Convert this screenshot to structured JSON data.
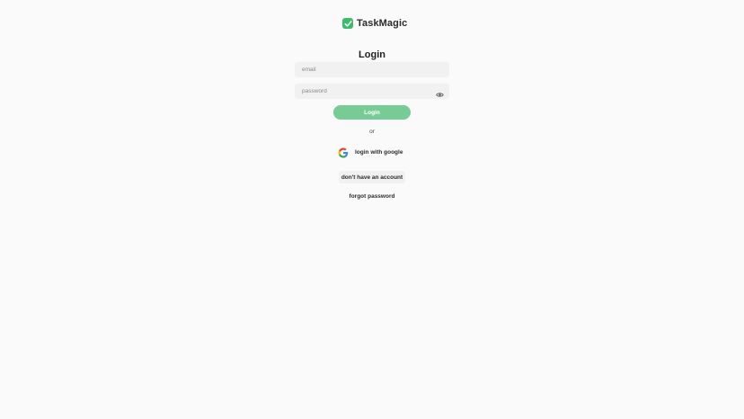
{
  "brand": {
    "name": "TaskMagic",
    "accent_color": "#3dbb6d",
    "logo_icon": "checkmark-badge-icon"
  },
  "login_form": {
    "title": "Login",
    "email": {
      "placeholder": "email",
      "value": ""
    },
    "password": {
      "placeholder": "password",
      "value": "",
      "toggle_icon": "eye-icon"
    },
    "submit_label": "Login",
    "submit_color": "#77cc95",
    "divider_text": "or",
    "google": {
      "label": "login with google",
      "icon": "google-icon"
    },
    "signup_label": "don't have an account",
    "forgot_label": "forgot password"
  }
}
